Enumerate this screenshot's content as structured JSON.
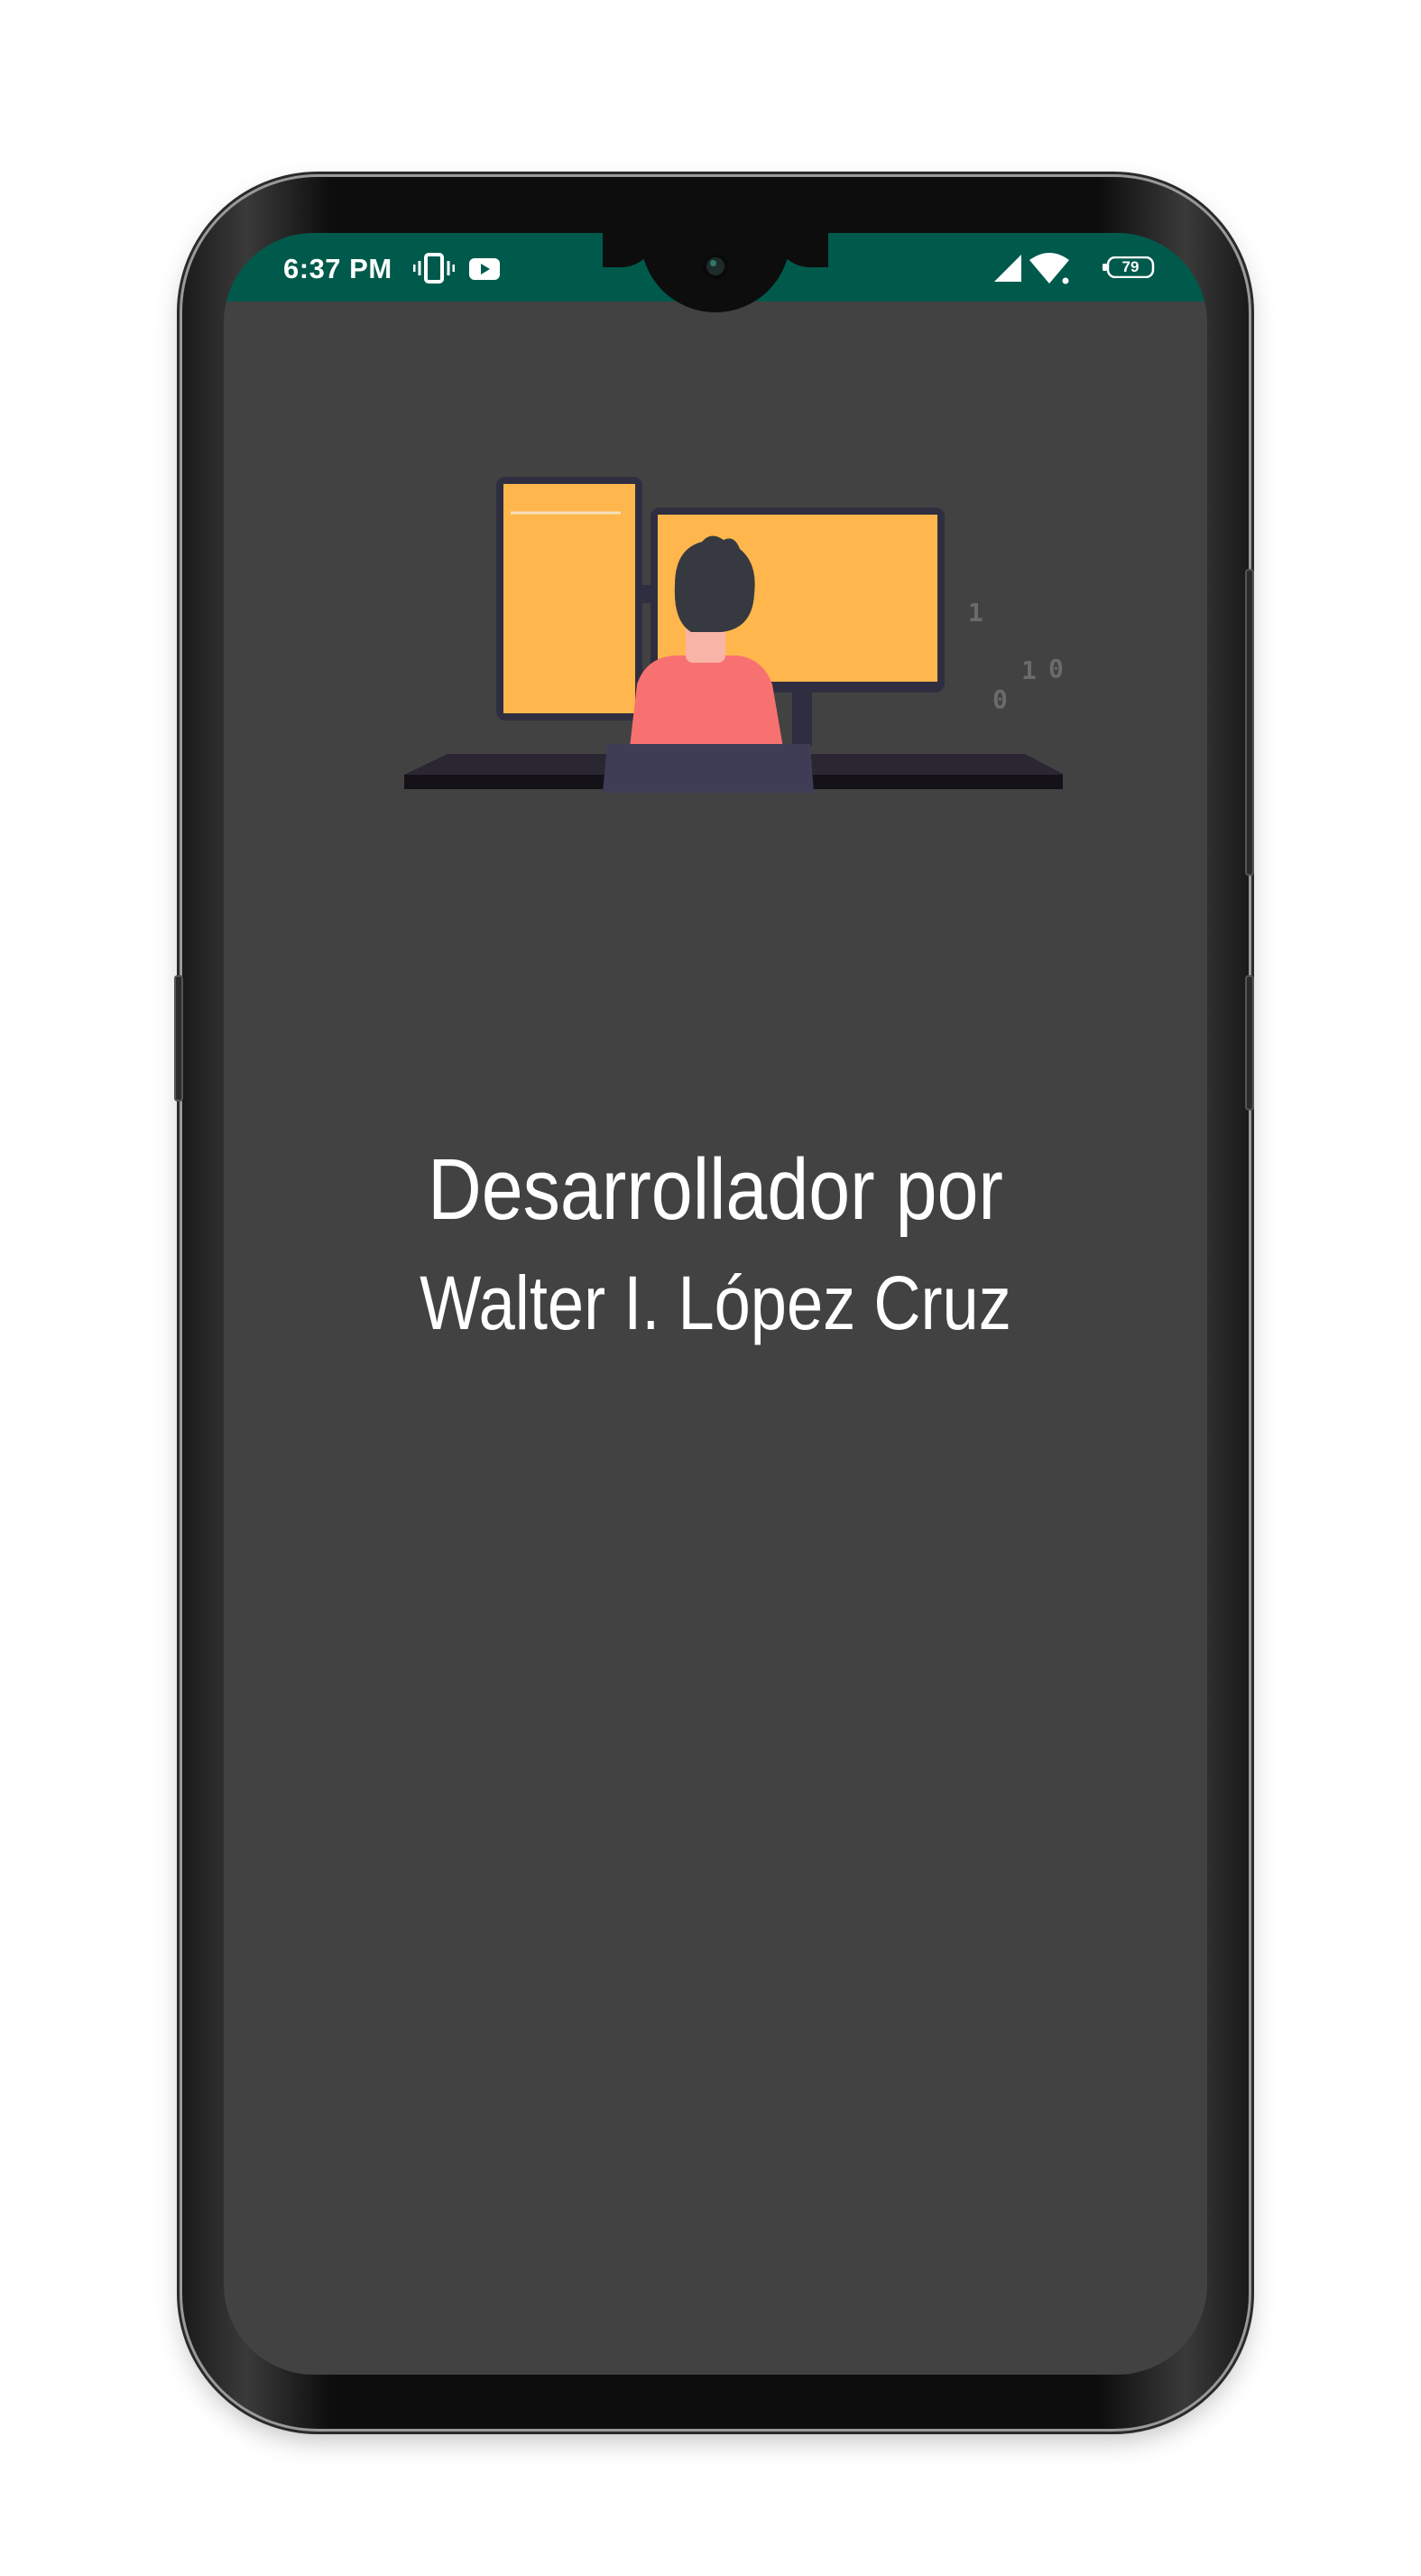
{
  "status_bar": {
    "time": "6:37 PM",
    "battery_level": "79",
    "icons": [
      "vibrate-icon",
      "youtube-icon",
      "cell-signal-icon",
      "wifi-icon",
      "battery-icon"
    ],
    "background_color": "#005a4c"
  },
  "illustration": {
    "binary_digits": [
      "1",
      "1",
      "0",
      "0"
    ],
    "accent_color": "#ffb74d",
    "shirt_color": "#f87171"
  },
  "main": {
    "title_line1": "Desarrollador por",
    "title_line2": "Walter I. López Cruz",
    "background_color": "#424242"
  }
}
